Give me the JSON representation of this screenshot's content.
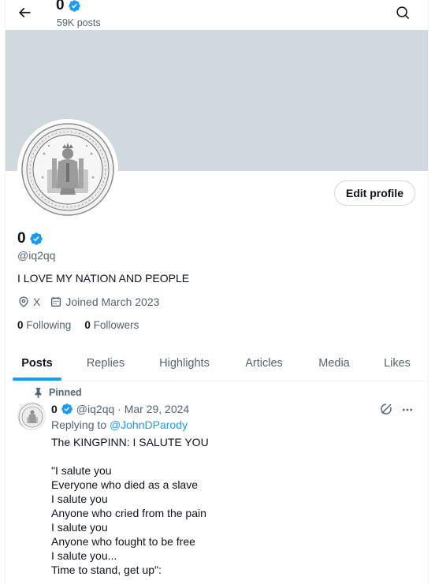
{
  "header": {
    "name": "0",
    "post_count": "59K posts",
    "back_icon": "arrow-left-icon",
    "search_icon": "search-icon"
  },
  "profile": {
    "display_name": "0",
    "handle": "@iq2qq",
    "bio": "I LOVE MY NATION AND PEOPLE",
    "location": "X",
    "joined": "Joined March 2023",
    "following_count": "0",
    "following_label": "Following",
    "followers_count": "0",
    "followers_label": "Followers",
    "edit_label": "Edit profile",
    "verified_color": "#1d9bf0"
  },
  "tabs": [
    "Posts",
    "Replies",
    "Highlights",
    "Articles",
    "Media",
    "Likes"
  ],
  "active_tab": "Posts",
  "pinned_post": {
    "pinned_label": "Pinned",
    "author_name": "0",
    "handle_date": "@iq2qq · Mar 29, 2024",
    "replying_label": "Replying to",
    "replying_to": "@JohnDParody",
    "lines": [
      "The KINGPINN: I SALUTE YOU",
      "",
      "\"I salute you",
      "Everyone who died as a slave",
      "I salute you",
      "Anyone who cried from the pain",
      "I salute you",
      "Anyone who fought to be free",
      "I salute you...",
      "Time to stand, get up\":"
    ]
  },
  "colors": {
    "accent": "#1d9bf0",
    "banner": "#cfd9de",
    "muted_text": "#536471"
  }
}
